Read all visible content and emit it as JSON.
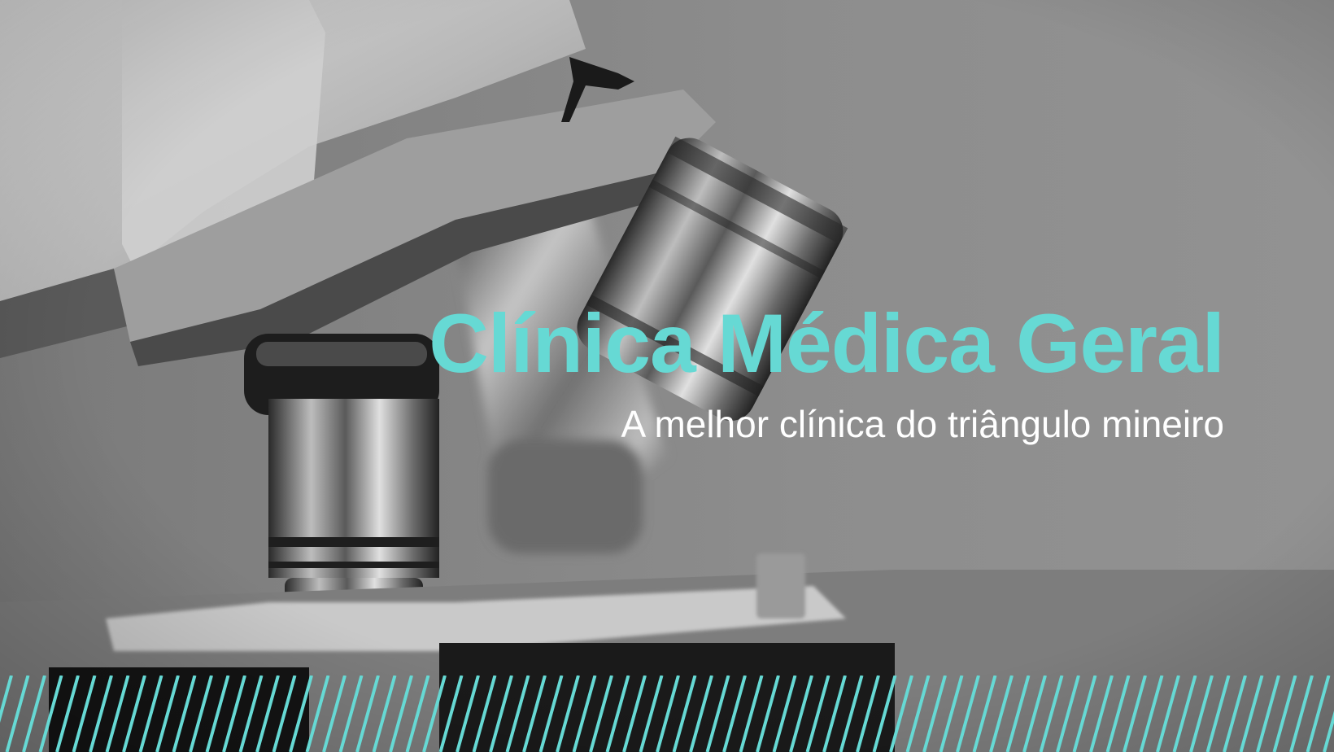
{
  "hero": {
    "title": "Clínica Médica Geral",
    "subtitle": "A melhor clínica do triângulo mineiro",
    "image_subject": "microscope-photo"
  },
  "colors": {
    "accent": "#66d9d4",
    "text_light": "#ffffff",
    "photo_tone": "#8e8e8e"
  },
  "decoration": {
    "stripe_pattern": "diagonal-stripes"
  }
}
